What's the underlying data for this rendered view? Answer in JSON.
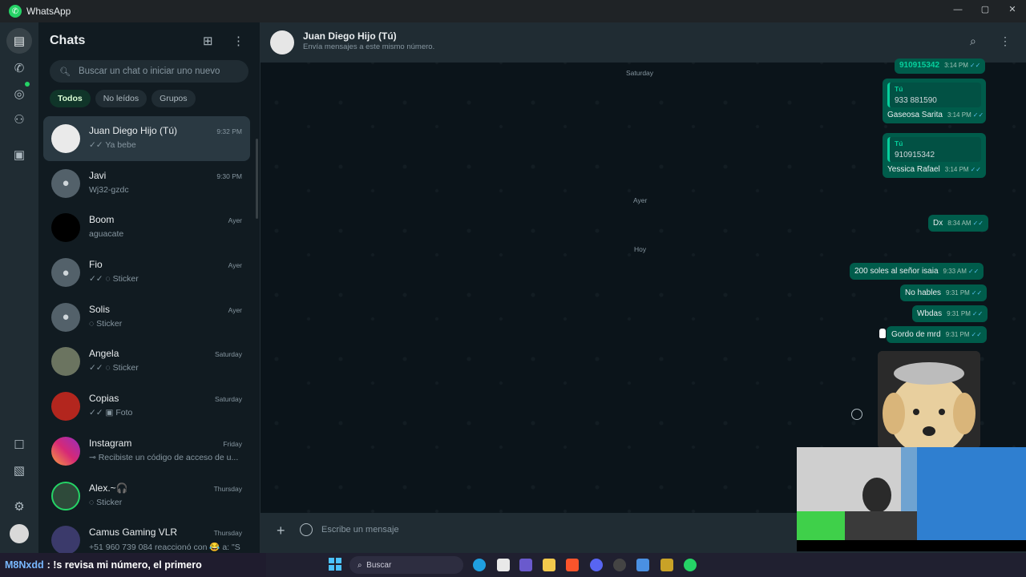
{
  "app": {
    "title": "WhatsApp"
  },
  "window_controls": {
    "minimize": "—",
    "maximize": "▢",
    "close": "✕"
  },
  "sidebar": {
    "title": "Chats",
    "search_placeholder": "Buscar un chat o iniciar uno nuevo",
    "filters": [
      "Todos",
      "No leídos",
      "Grupos"
    ],
    "chats": [
      {
        "name": "Juan Diego Hijo (Tú)",
        "time": "9:32 PM",
        "preview": "✓✓ Ya bebe"
      },
      {
        "name": "Javi",
        "time": "9:30 PM",
        "preview": "Wj32-gzdc"
      },
      {
        "name": "Boom",
        "time": "Ayer",
        "preview": "aguacate"
      },
      {
        "name": "Fio",
        "time": "Ayer",
        "preview": "✓✓ ◌ Sticker"
      },
      {
        "name": "Solis",
        "time": "Ayer",
        "preview": "◌ Sticker"
      },
      {
        "name": "Angela",
        "time": "Saturday",
        "preview": "✓✓ ◌ Sticker"
      },
      {
        "name": "Copias",
        "time": "Saturday",
        "preview": "✓✓ ▣ Foto"
      },
      {
        "name": "Instagram",
        "time": "Friday",
        "preview": "⊸ Recibiste un código de acceso de u..."
      },
      {
        "name": "Alex.~🎧",
        "time": "Thursday",
        "preview": "◌ Sticker"
      },
      {
        "name": "Camus Gaming VLR",
        "time": "Thursday",
        "preview": "+51 960 739 084 reaccionó con 😂 a: \"S"
      }
    ]
  },
  "chat": {
    "name": "Juan Diego Hijo (Tú)",
    "subtitle": "Envía mensajes a este mismo número.",
    "days": [
      "Saturday",
      "Ayer",
      "Hoy"
    ],
    "messages": {
      "m0": {
        "text": "910915342",
        "time": "3:14 PM"
      },
      "m1": {
        "quote_name": "Tú",
        "quote_text": "933 881590",
        "text": "Gaseosa Sarita",
        "time": "3:14 PM"
      },
      "m2": {
        "quote_name": "Tú",
        "quote_text": "910915342",
        "text": "Yessica Rafael",
        "time": "3:14 PM"
      },
      "m3": {
        "text": "Dx",
        "time": "8:34 AM"
      },
      "m4": {
        "text": "200 soles al señor isaia",
        "time": "9:33 AM"
      },
      "m5": {
        "text": "No hables",
        "time": "9:31 PM"
      },
      "m6": {
        "text": "Wbdas",
        "time": "9:31 PM"
      },
      "m7": {
        "text": "Gordo de mrd",
        "time": "9:31 PM"
      }
    },
    "input_placeholder": "Escribe un mensaje"
  },
  "stream_overlay": {
    "user": "M8Nxdd",
    "message": ": !s revisa mi número, el primero"
  },
  "taskbar": {
    "search_label": "Buscar"
  },
  "colors": {
    "accent": "#25d366",
    "bubble_out": "#005c4b",
    "background": "#0b141a"
  }
}
